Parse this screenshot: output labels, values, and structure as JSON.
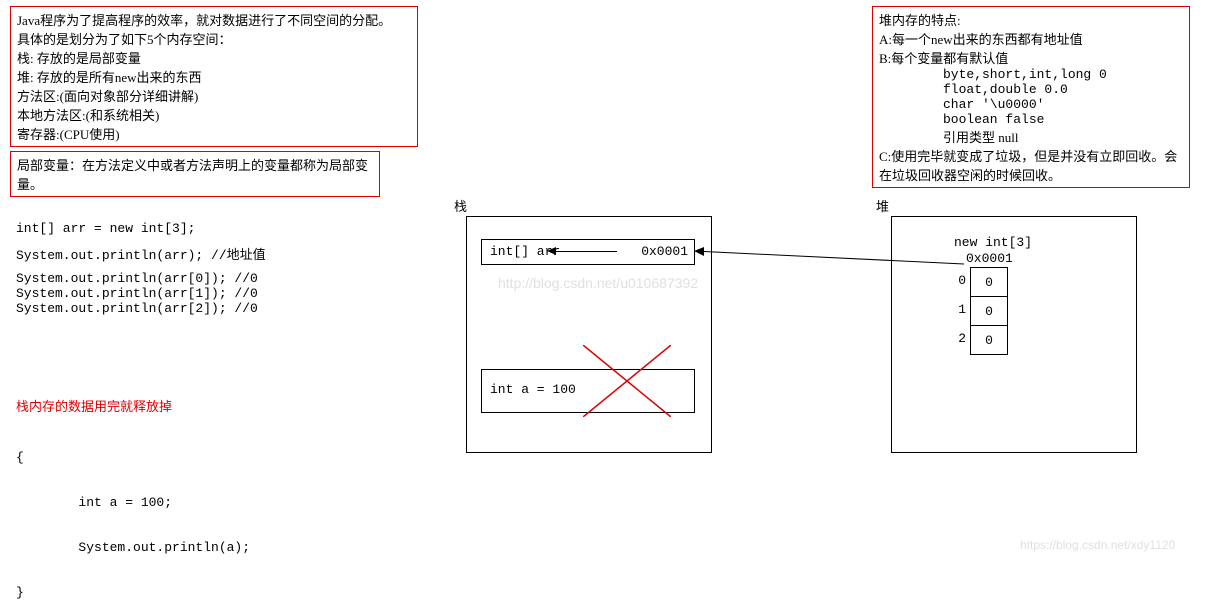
{
  "topbox": {
    "line1": "Java程序为了提高程序的效率，就对数据进行了不同空间的分配。",
    "line2": "具体的是划分为了如下5个内存空间：",
    "line3": "栈: 存放的是局部变量",
    "line4": "堆: 存放的是所有new出来的东西",
    "line5": "方法区:(面向对象部分详细讲解)",
    "line6": "本地方法区:(和系统相关)",
    "line7": "寄存器:(CPU使用)"
  },
  "localvar": "局部变量：在方法定义中或者方法声明上的变量都称为局部变量。",
  "code": {
    "c1": "int[] arr = new int[3];",
    "c2": "System.out.println(arr); //地址值",
    "c3": "System.out.println(arr[0]); //0",
    "c4": "System.out.println(arr[1]); //0",
    "c5": "System.out.println(arr[2]); //0"
  },
  "release": "栈内存的数据用完就释放掉",
  "code2": {
    "l1": "{",
    "l2": "        int a = 100;",
    "l3": "        System.out.println(a);",
    "l4": "}"
  },
  "stack": {
    "title": "栈",
    "arr_decl": "int[] arr",
    "addr": "0x0001",
    "inta": "int a = 100"
  },
  "heap": {
    "title": "堆",
    "newint": "new int[3]",
    "addr": "0x0001",
    "idx0": "0",
    "idx1": "1",
    "idx2": "2",
    "v0": "0",
    "v1": "0",
    "v2": "0"
  },
  "heapbox": {
    "l1": "堆内存的特点:",
    "l2": "A:每一个new出来的东西都有地址值",
    "l3": "B:每个变量都有默认值",
    "l4": "byte,short,int,long 0",
    "l5": "float,double 0.0",
    "l6": "char '\\u0000'",
    "l7": "boolean false",
    "l8": "引用类型 null",
    "l9": "C:使用完毕就变成了垃圾，但是并没有立即回收。会在垃圾回收器空闲的时候回收。"
  },
  "wm1": "http://blog.csdn.net/u010687392",
  "wm2": "https://blog.csdn.net/xdy1120"
}
